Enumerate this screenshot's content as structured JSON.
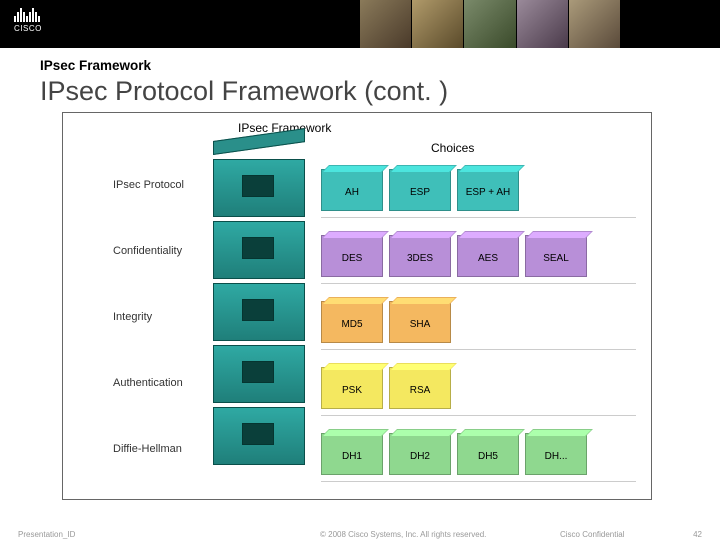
{
  "header": {
    "logo_text": "CISCO",
    "subtitle": "IPsec Framework",
    "title": "IPsec Protocol Framework (cont. )"
  },
  "diagram": {
    "framework_label": "IPsec Framework",
    "choices_label": "Choices",
    "rows": [
      {
        "label": "IPsec Protocol",
        "color": "teal",
        "items": [
          "AH",
          "ESP",
          "ESP + AH"
        ]
      },
      {
        "label": "Confidentiality",
        "color": "purple",
        "items": [
          "DES",
          "3DES",
          "AES",
          "SEAL"
        ]
      },
      {
        "label": "Integrity",
        "color": "orange",
        "items": [
          "MD5",
          "SHA"
        ]
      },
      {
        "label": "Authentication",
        "color": "yellow",
        "items": [
          "PSK",
          "RSA"
        ]
      },
      {
        "label": "Diffie-Hellman",
        "color": "green",
        "items": [
          "DH1",
          "DH2",
          "DH5",
          "DH..."
        ]
      }
    ]
  },
  "footer": {
    "presentation_id": "Presentation_ID",
    "copyright": "© 2008 Cisco Systems, Inc. All rights reserved.",
    "confidential": "Cisco Confidential",
    "page": "42"
  }
}
